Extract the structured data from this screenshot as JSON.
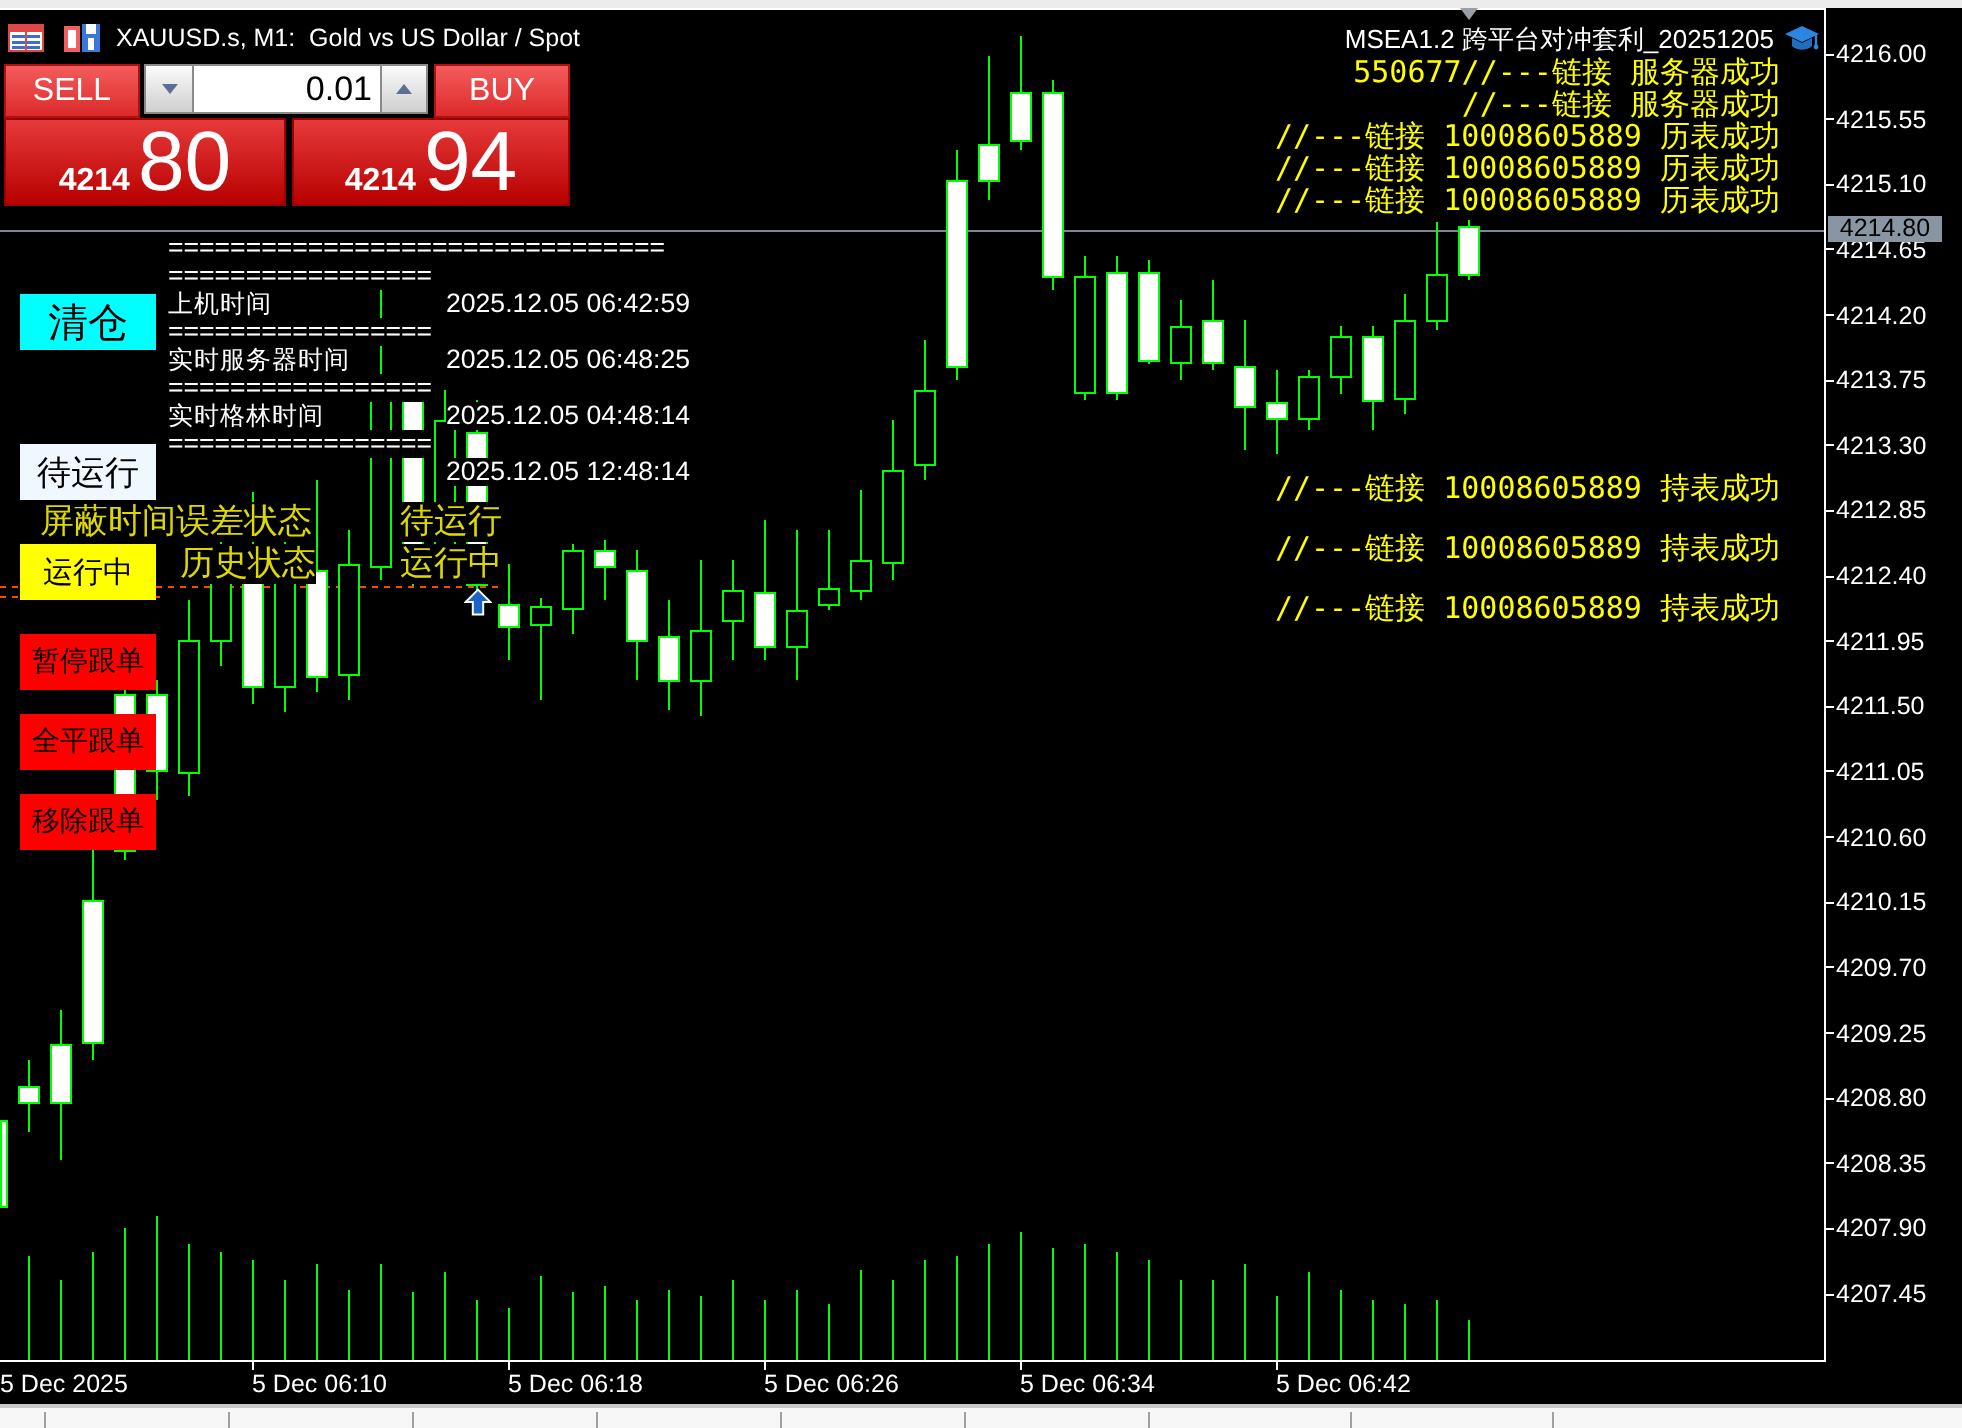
{
  "chart_header": {
    "title": "XAUUSD.s, M1:  Gold vs US Dollar / Spot",
    "expert_name": "MSEA1.2 跨平台对冲套利_20251205"
  },
  "trade_panel": {
    "sell": {
      "label": "SELL",
      "price_big_figure": "4214",
      "price_points": "80"
    },
    "lot": "0.01",
    "buy": {
      "label": "BUY",
      "price_big_figure": "4214",
      "price_points": "94"
    }
  },
  "info_lines": [
    {
      "kind": "rule",
      "text": "================================"
    },
    {
      "kind": "rule",
      "text": "================="
    },
    {
      "kind": "row",
      "label": "上机时间",
      "value": "2025.12.05 06:42:59"
    },
    {
      "kind": "rule",
      "text": "================="
    },
    {
      "kind": "row",
      "label": "实时服务器时间",
      "value": "2025.12.05 06:48:25"
    },
    {
      "kind": "rule",
      "text": "================="
    },
    {
      "kind": "row",
      "label": "实时格林时间",
      "value": "2025.12.05 04:48:14"
    },
    {
      "kind": "rule",
      "text": "================="
    },
    {
      "kind": "row",
      "value": "2025.12.05 12:48:14"
    }
  ],
  "object_buttons": [
    {
      "label": "清仓",
      "color": "#00ffff"
    },
    {
      "label": "待运行",
      "color": "#f0f8ff"
    },
    {
      "label": "运行中",
      "color": "#ffff00"
    },
    {
      "label": "暂停跟单",
      "color": "#ff0000"
    },
    {
      "label": "全平跟单",
      "color": "#ff0000"
    },
    {
      "label": "移除跟单",
      "color": "#ff0000"
    }
  ],
  "status_labels": [
    "屏蔽时间误差状态",
    "待运行",
    "历史状态",
    "运行中"
  ],
  "log_messages": [
    "550677//---链接 服务器成功",
    "//---链接 服务器成功",
    "//---链接 10008605889 历表成功",
    "//---链接 10008605889 历表成功",
    "//---链接 10008605889 历表成功",
    "//---链接 10008605889 持表成功",
    "//---链接 10008605889 持表成功",
    "//---链接 10008605889 持表成功"
  ],
  "price_axis": {
    "ticks": [
      "4216.00",
      "4215.55",
      "4215.10",
      "4214.65",
      "4214.20",
      "4213.75",
      "4213.30",
      "4212.85",
      "4212.40",
      "4211.95",
      "4211.50",
      "4211.05",
      "4210.60",
      "4210.15",
      "4209.70",
      "4209.25",
      "4208.80",
      "4208.35",
      "4207.90",
      "4207.45"
    ],
    "current_price": "4214.80"
  },
  "time_axis": {
    "ticks": [
      "5 Dec 2025",
      "5 Dec 06:10",
      "5 Dec 06:18",
      "5 Dec 06:26",
      "5 Dec 06:34",
      "5 Dec 06:42"
    ]
  }
}
